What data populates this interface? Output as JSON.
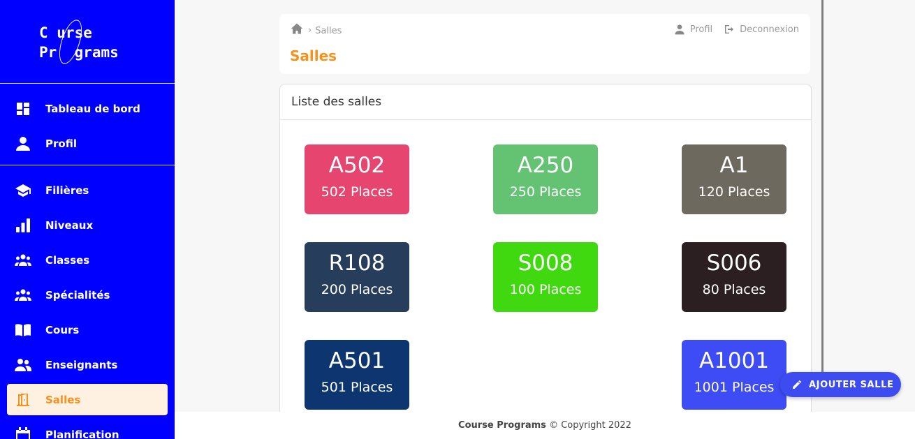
{
  "logo": {
    "line1": "C urse",
    "line2": "Pr  grams"
  },
  "sidebar": {
    "group1": [
      {
        "label": "Tableau de bord",
        "icon": "dashboard-icon"
      },
      {
        "label": "Profil",
        "icon": "person-icon"
      }
    ],
    "group2": [
      {
        "label": "Filières",
        "icon": "graduation-cap-icon"
      },
      {
        "label": "Niveaux",
        "icon": "bar-chart-icon"
      },
      {
        "label": "Classes",
        "icon": "group-icon"
      },
      {
        "label": "Spécialités",
        "icon": "group-icon"
      },
      {
        "label": "Cours",
        "icon": "book-icon"
      },
      {
        "label": "Enseignants",
        "icon": "people-icon"
      },
      {
        "label": "Salles",
        "icon": "door-icon",
        "active": true
      },
      {
        "label": "Planification",
        "icon": "calendar-icon"
      }
    ]
  },
  "breadcrumb": {
    "current": "Salles"
  },
  "header": {
    "title": "Salles",
    "profile_label": "Profil",
    "logout_label": "Deconnexion"
  },
  "list": {
    "heading": "Liste des salles",
    "rooms": [
      {
        "name": "A502",
        "places": "502 Places",
        "color": "#e6456f"
      },
      {
        "name": "A250",
        "places": "250 Places",
        "color": "#63c372"
      },
      {
        "name": "A1",
        "places": "120 Places",
        "color": "#6e695f"
      },
      {
        "name": "R108",
        "places": "200 Places",
        "color": "#273d5c"
      },
      {
        "name": "S008",
        "places": "100 Places",
        "color": "#40d90f"
      },
      {
        "name": "S006",
        "places": "80 Places",
        "color": "#2b1f22"
      },
      {
        "name": "A501",
        "places": "501 Places",
        "color": "#0d3570"
      },
      {
        "name": "A1001",
        "places": "1001 Places",
        "color": "#3d4cf5"
      }
    ]
  },
  "fab": {
    "label": "AJOUTER SALLE"
  },
  "footer": {
    "brand": "Course Programs",
    "copyright": "© Copyright 2022"
  },
  "colors": {
    "sidebar": "#0000ff",
    "accent": "#f5921e",
    "fab": "#3d4cf0"
  }
}
